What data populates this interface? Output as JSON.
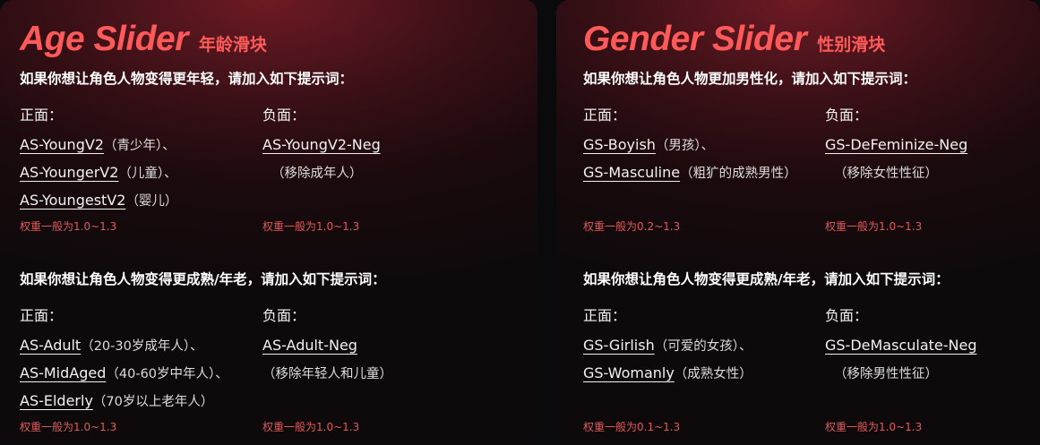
{
  "age": {
    "title": "Age Slider",
    "title_cn": "年龄滑块",
    "younger": {
      "heading": "如果你想让角色人物变得更年轻，请加入如下提示词：",
      "positive_label": "正面：",
      "negative_label": "负面：",
      "positive": [
        {
          "kw": "AS-YoungV2",
          "note": "（青少年）、"
        },
        {
          "kw": "AS-YoungerV2",
          "note": "（儿童）、"
        },
        {
          "kw": "AS-YoungestV2",
          "note": "（婴儿）"
        }
      ],
      "negative": {
        "kw": "AS-YoungV2-Neg",
        "note": "（移除成年人）"
      },
      "positive_weight": "权重一般为1.0~1.3",
      "negative_weight": "权重一般为1.0~1.3"
    },
    "older": {
      "heading": "如果你想让角色人物变得更成熟/年老，请加入如下提示词：",
      "positive_label": "正面：",
      "negative_label": "负面：",
      "positive": [
        {
          "kw": "AS-Adult",
          "note": "（20-30岁成年人）、"
        },
        {
          "kw": "AS-MidAged",
          "note": "（40-60岁中年人）、"
        },
        {
          "kw": "AS-Elderly",
          "note": "（70岁以上老年人）"
        }
      ],
      "negative": {
        "kw": "AS-Adult-Neg",
        "note": "（移除年轻人和儿童）"
      },
      "positive_weight": "权重一般为1.0~1.3",
      "negative_weight": "权重一般为1.0~1.3"
    }
  },
  "gender": {
    "title": "Gender Slider",
    "title_cn": "性别滑块",
    "male": {
      "heading": "如果你想让角色人物更加男性化，请加入如下提示词：",
      "positive_label": "正面：",
      "negative_label": "负面：",
      "positive": [
        {
          "kw": "GS-Boyish",
          "note": "（男孩）、"
        },
        {
          "kw": "GS-Masculine",
          "note": "（粗犷的成熟男性）"
        }
      ],
      "negative": {
        "kw": "GS-DeFeminize-Neg",
        "note": "（移除女性性征）"
      },
      "positive_weight": "权重一般为0.2~1.3",
      "negative_weight": "权重一般为1.0~1.3"
    },
    "female": {
      "heading": "如果你想让角色人物变得更成熟/年老，请加入如下提示词：",
      "positive_label": "正面：",
      "negative_label": "负面：",
      "positive": [
        {
          "kw": "GS-Girlish",
          "note": "（可爱的女孩）、"
        },
        {
          "kw": "GS-Womanly",
          "note": "（成熟女性）"
        }
      ],
      "negative": {
        "kw": "GS-DeMasculate-Neg",
        "note": "（移除男性性征）"
      },
      "positive_weight": "权重一般为0.1~1.3",
      "negative_weight": "权重一般为1.0~1.3"
    }
  }
}
